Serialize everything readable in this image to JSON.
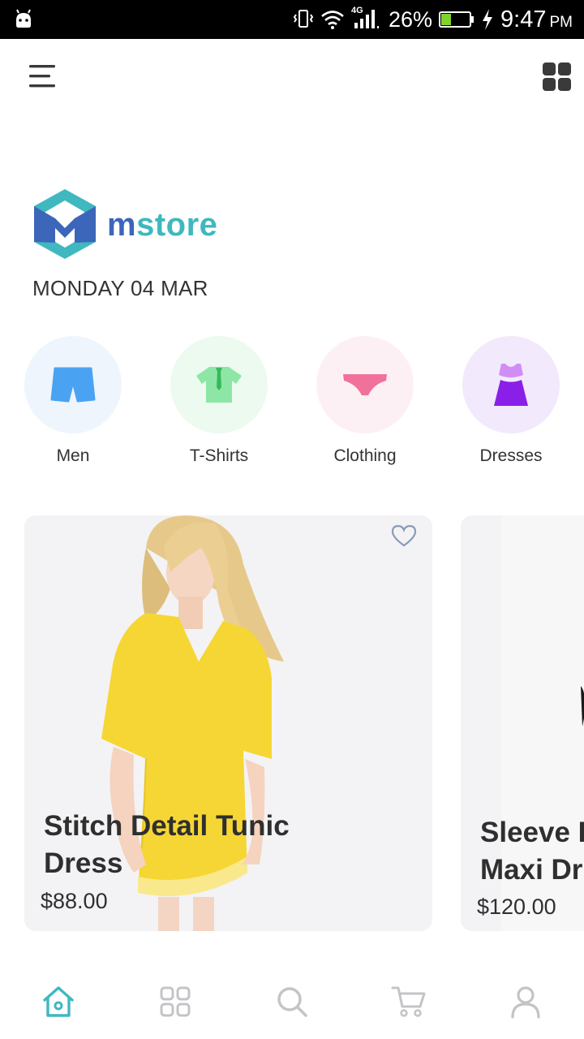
{
  "status_bar": {
    "battery_percent": "26%",
    "time": "9:47",
    "ampm": "PM",
    "network": "4G"
  },
  "header": {
    "menu_icon": "hamburger-menu-icon",
    "layout_icon": "grid-view-icon"
  },
  "brand": {
    "name_m": "m",
    "name_rest": "store",
    "date": "MONDAY 04 MAR",
    "colors": {
      "primary": "#3c66b9",
      "accent": "#3fb8bf"
    }
  },
  "categories": [
    {
      "label": "Men",
      "icon": "shorts-icon",
      "bg": "#eef5fd",
      "color": "#4aa3f2"
    },
    {
      "label": "T-Shirts",
      "icon": "tshirt-icon",
      "bg": "#ecfaef",
      "color": "#8ee6a6"
    },
    {
      "label": "Clothing",
      "icon": "underwear-icon",
      "bg": "#fdf0f4",
      "color": "#f0719a"
    },
    {
      "label": "Dresses",
      "icon": "dress-icon",
      "bg": "#f2e9fc",
      "color": "#8a1fe8"
    }
  ],
  "products": [
    {
      "title_line1": "Stitch Detail Tunic",
      "title_line2": "Dress",
      "price": "$88.00",
      "favorite": false
    },
    {
      "title_line1": "Sleeve D",
      "title_line2": "Maxi Dr",
      "price": "$120.00",
      "favorite": false
    }
  ],
  "bottom_nav": [
    {
      "icon": "home-icon",
      "active": true
    },
    {
      "icon": "categories-icon",
      "active": false
    },
    {
      "icon": "search-icon",
      "active": false
    },
    {
      "icon": "cart-icon",
      "active": false
    },
    {
      "icon": "profile-icon",
      "active": false
    }
  ]
}
